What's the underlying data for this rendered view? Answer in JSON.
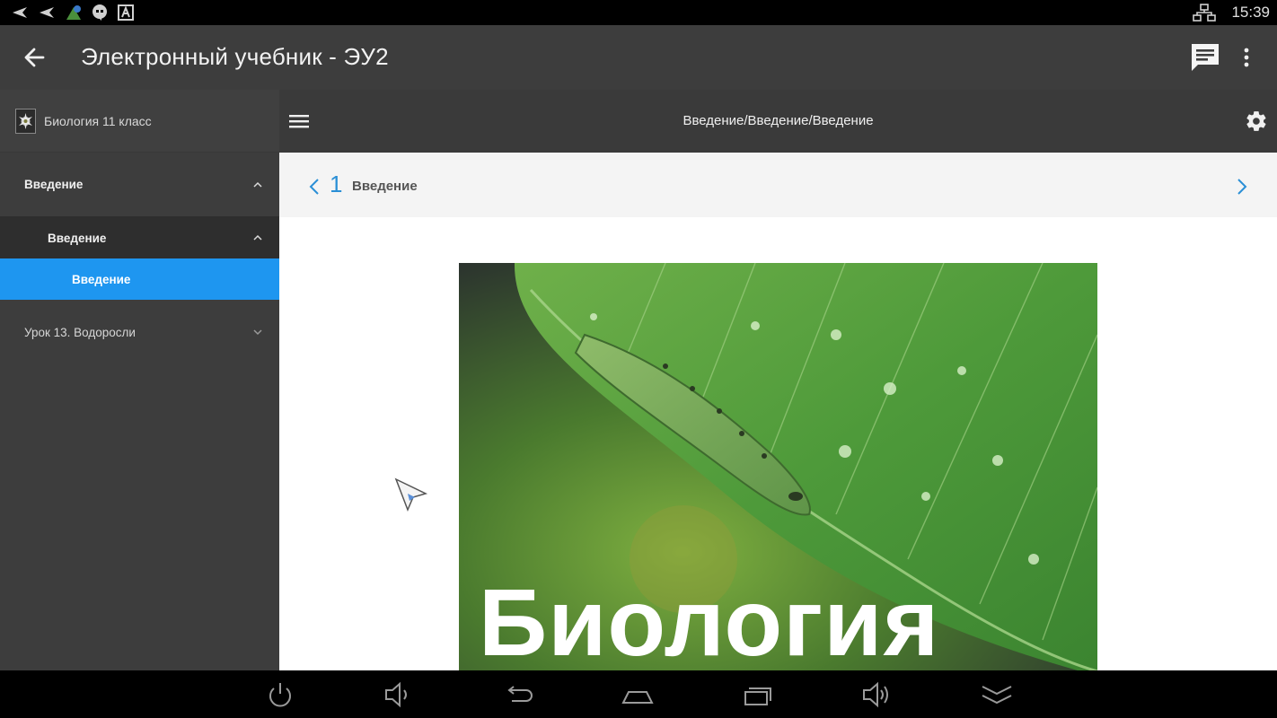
{
  "status_bar": {
    "time": "15:39",
    "icons": [
      "back-arrow-icon",
      "back-arrow-icon",
      "app-icon",
      "chat-bubble-icon",
      "text-icon",
      "network-icon"
    ]
  },
  "app_bar": {
    "title": "Электронный учебник - ЭУ2",
    "icons": [
      "back-arrow-icon",
      "message-icon",
      "more-vert-icon"
    ]
  },
  "sidebar": {
    "book_title": "Биология 11 класс",
    "items": [
      {
        "label": "Введение",
        "level": 1,
        "expanded": true
      },
      {
        "label": "Введение",
        "level": 2,
        "expanded": true
      },
      {
        "label": "Введение",
        "level": 3,
        "selected": true
      },
      {
        "label": "Урок 13. Водоросли",
        "level": 1,
        "expanded": false
      }
    ]
  },
  "content_bar": {
    "breadcrumb": "Введение/Введение/Введение",
    "icons": [
      "menu-icon",
      "settings-icon"
    ]
  },
  "page_nav": {
    "page_number": "1",
    "page_title": "Введение",
    "icons": [
      "chevron-left-icon",
      "chevron-right-icon"
    ]
  },
  "cover": {
    "title": "Биология"
  },
  "nav_bar": {
    "icons": [
      "power-icon",
      "volume-down-icon",
      "back-icon",
      "home-icon",
      "recents-icon",
      "volume-up-icon",
      "collapse-icon"
    ]
  },
  "colors": {
    "accent": "#1e96f0",
    "page_number": "#2a8fd6",
    "app_bar": "#3d3d3d",
    "sidebar": "#3d3d3d"
  }
}
